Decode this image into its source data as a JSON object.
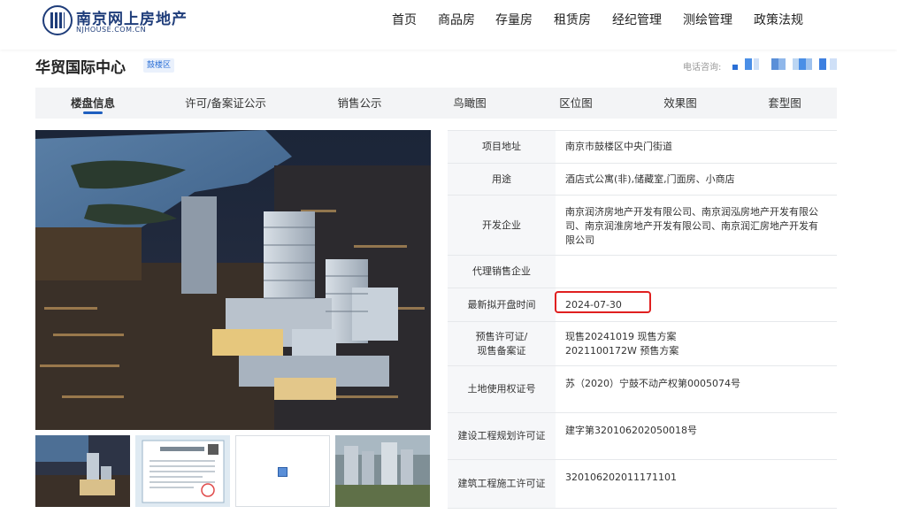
{
  "site": {
    "name_cn": "南京网上房地产",
    "name_en": "NJHOUSE.COM.CN",
    "logo_icon": "building-logo-icon"
  },
  "nav": [
    "首页",
    "商品房",
    "存量房",
    "租赁房",
    "经纪管理",
    "测绘管理",
    "政策法规"
  ],
  "project": {
    "title": "华贸国际中心",
    "district": "鼓楼区",
    "phone_label": "电话咨询:"
  },
  "tabs": [
    "楼盘信息",
    "许可/备案证公示",
    "销售公示",
    "鸟瞰图",
    "区位图",
    "效果图",
    "套型图"
  ],
  "active_tab": "楼盘信息",
  "info": {
    "address_label": "项目地址",
    "address": "南京市鼓楼区中央门街道",
    "usage_label": "用途",
    "usage": "酒店式公寓(非),储藏室,门面房、小商店",
    "developer_label": "开发企业",
    "developers": "南京润济房地产开发有限公司、南京润泓房地产开发有限公司、南京润淮房地产开发有限公司、南京润汇房地产开发有限公司",
    "agent_label": "代理销售企业",
    "agent": "",
    "open_date_label": "最新拟开盘时间",
    "open_date": "2024-07-30",
    "presale_label_1": "预售许可证/",
    "presale_label_2": "现售备案证",
    "presale_1": "现售20241019 现售方案",
    "presale_2": "2021100172W 预售方案",
    "land_label": "土地使用权证号",
    "land": "苏（2020）宁鼓不动产权第0005074号",
    "planning_label": "建设工程规划许可证",
    "planning": "建字第320106202050018号",
    "construction_label": "建筑工程施工许可证",
    "construction": "320106202011171101"
  },
  "colors": {
    "brand": "#1f3d7a",
    "link": "#1f5fbf",
    "highlight": "#e02020",
    "tab_bg": "#f3f4f6"
  }
}
